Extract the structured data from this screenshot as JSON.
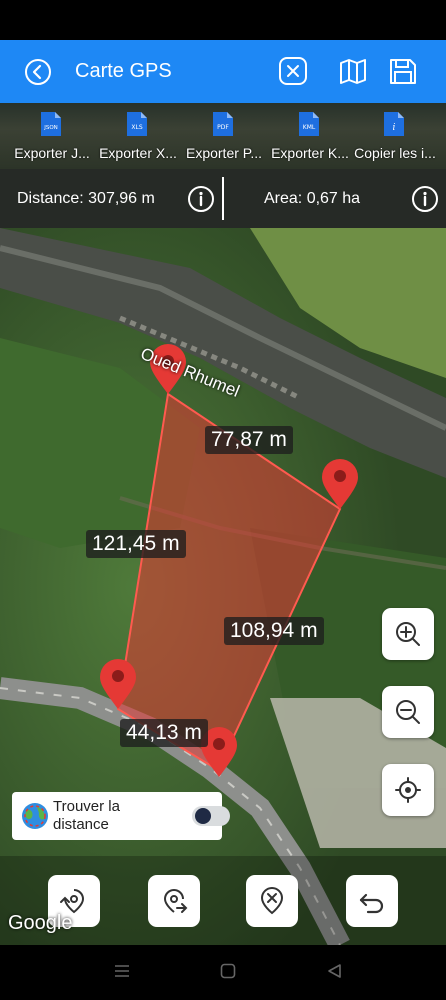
{
  "app_bar": {
    "title": "Carte GPS",
    "back_icon": "back-circle-icon",
    "actions": [
      "close-square-icon",
      "map-icon",
      "save-icon"
    ],
    "color": "#1e88f5"
  },
  "exports": [
    {
      "label": "Exporter J...",
      "badge": "JSON"
    },
    {
      "label": "Exporter X...",
      "badge": "XLS"
    },
    {
      "label": "Exporter P...",
      "badge": "PDF"
    },
    {
      "label": "Exporter K...",
      "badge": "KML"
    },
    {
      "label": "Copier les i...",
      "badge": "i"
    }
  ],
  "stats": {
    "distance": "Distance: 307,96 m",
    "area": "Area: 0,67 ha"
  },
  "map": {
    "river_label": "Oued Rhumel",
    "segments": [
      "77,87 m",
      "121,45 m",
      "108,94 m",
      "44,13 m"
    ],
    "polygon_color": "#e53935",
    "attribution": "Google"
  },
  "finder": {
    "label": "Trouver la distance",
    "toggle_on": false
  },
  "zoom_controls": [
    "zoom-in-icon",
    "zoom-out-icon",
    "locate-icon"
  ],
  "bottom_tools": [
    "rotate-pin-icon",
    "pin-forward-icon",
    "pin-remove-icon",
    "undo-icon"
  ],
  "system_nav": [
    "menu-icon",
    "home-icon",
    "back-triangle-icon"
  ]
}
